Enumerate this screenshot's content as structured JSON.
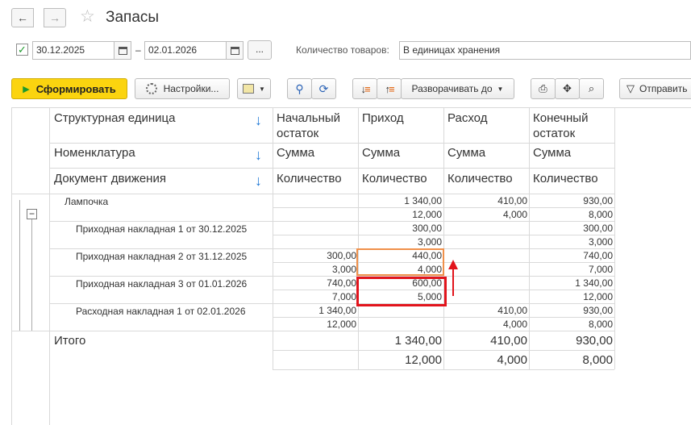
{
  "window": {
    "title": "Запасы",
    "back_icon": "←",
    "forward_icon": "→",
    "favorite_icon": "☆"
  },
  "period": {
    "enabled_mark": "✓",
    "date_from": "30.12.2025",
    "separator": "–",
    "date_to": "02.01.2026",
    "more_label": "...",
    "qty_label": "Количество товаров:",
    "qty_value": "В единицах хранения"
  },
  "toolbar": {
    "generate_label": "Сформировать",
    "settings_label": "Настройки...",
    "expand_label": "Разворачивать до",
    "send_label": "Отправить",
    "accent": "#fbd40f"
  },
  "report": {
    "headers": {
      "grouping_1": "Структурная единица",
      "grouping_2": "Номенклатура",
      "grouping_3": "Документ движения",
      "opening_1": "Начальный",
      "opening_2": "остаток",
      "receipt": "Приход",
      "expense": "Расход",
      "closing_1": "Конечный",
      "closing_2": "остаток",
      "sum": "Сумма",
      "quantity": "Количество"
    },
    "rows": [
      {
        "label": "Лампочка",
        "open_sum": "",
        "open_qty": "",
        "in_sum": "1 340,00",
        "in_qty": "12,000",
        "out_sum": "410,00",
        "out_qty": "4,000",
        "close_sum": "930,00",
        "close_qty": "8,000"
      },
      {
        "label": "Приходная накладная 1 от 30.12.2025",
        "open_sum": "",
        "open_qty": "",
        "in_sum": "300,00",
        "in_qty": "3,000",
        "out_sum": "",
        "out_qty": "",
        "close_sum": "300,00",
        "close_qty": "3,000"
      },
      {
        "label": "Приходная накладная 2 от 31.12.2025",
        "open_sum": "300,00",
        "open_qty": "3,000",
        "in_sum": "440,00",
        "in_qty": "4,000",
        "out_sum": "",
        "out_qty": "",
        "close_sum": "740,00",
        "close_qty": "7,000"
      },
      {
        "label": "Приходная накладная 3 от 01.01.2026",
        "open_sum": "740,00",
        "open_qty": "7,000",
        "in_sum": "600,00",
        "in_qty": "5,000",
        "out_sum": "",
        "out_qty": "",
        "close_sum": "1 340,00",
        "close_qty": "12,000"
      },
      {
        "label": "Расходная накладная 1 от 02.01.2026",
        "open_sum": "1 340,00",
        "open_qty": "12,000",
        "in_sum": "",
        "in_qty": "",
        "out_sum": "410,00",
        "out_qty": "4,000",
        "close_sum": "930,00",
        "close_qty": "8,000"
      }
    ],
    "total": {
      "label": "Итого",
      "in_sum": "1 340,00",
      "in_qty": "12,000",
      "out_sum": "410,00",
      "out_qty": "4,000",
      "close_sum": "930,00",
      "close_qty": "8,000"
    },
    "collapse_mark": "−",
    "sort_arrow": "↓",
    "highlight_colors": {
      "orange": "#f0904a",
      "red": "#e2141c"
    }
  }
}
